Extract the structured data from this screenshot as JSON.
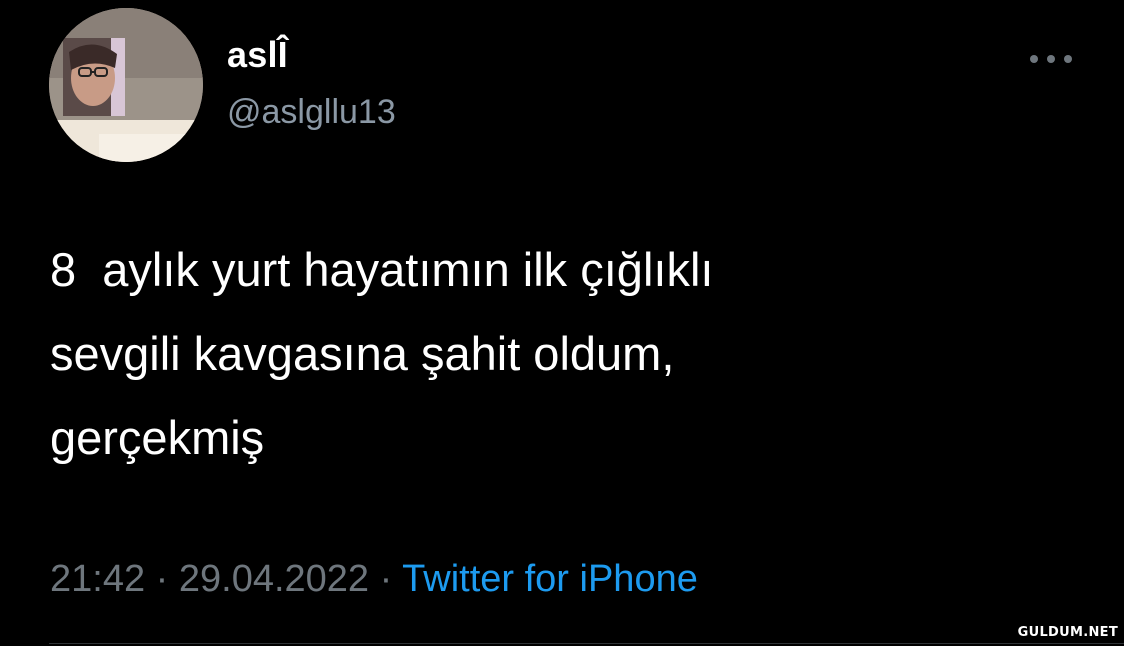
{
  "author": {
    "display_name": "aslÎ",
    "handle": "@aslgllu13",
    "avatar_icon": "profile-photo"
  },
  "tweet": {
    "text_lines": [
      "8  aylık yurt hayatımın ilk çığlıklı",
      "sevgili kavgasına şahit oldum,",
      "gerçekmiş"
    ]
  },
  "meta": {
    "time": "21:42",
    "separator": " · ",
    "date": "29.04.2022",
    "source": "Twitter for iPhone"
  },
  "watermark": "GULDUM.NET",
  "colors": {
    "background": "#000000",
    "primary_text": "#ffffff",
    "secondary_text": "#6e767d",
    "link": "#1d9bf0"
  },
  "icons": {
    "more": "more-horizontal-icon"
  }
}
